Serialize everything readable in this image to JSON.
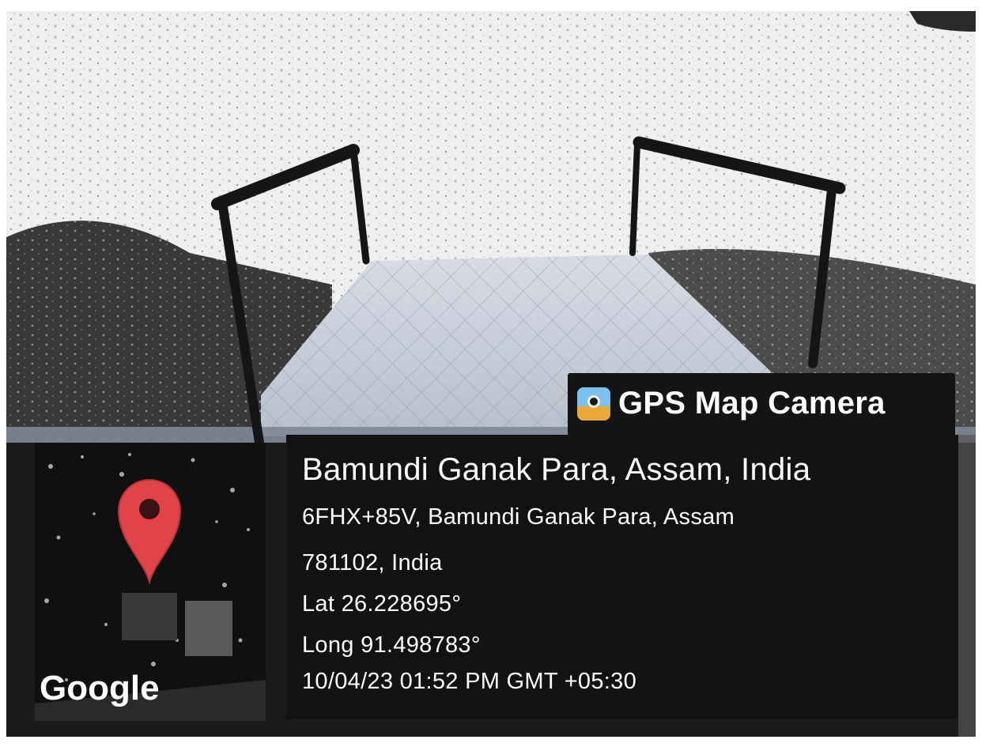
{
  "app": {
    "name": "GPS Map Camera",
    "icon": "gps-map-camera-app-icon"
  },
  "location": {
    "place_name": "Bamundi Ganak Para, Assam, India",
    "address_line_1": "6FHX+85V, Bamundi Ganak Para, Assam",
    "address_line_2": "781102, India",
    "latitude": "Lat 26.228695°",
    "longitude": "Long 91.498783°",
    "datetime": "10/04/23 01:52 PM GMT +05:30"
  },
  "map_thumbnail": {
    "attribution": "Google",
    "marker_icon": "map-pin-icon",
    "marker_color": "#e0444a"
  },
  "colors": {
    "panel_background": "#121212",
    "text": "#ffffff"
  }
}
